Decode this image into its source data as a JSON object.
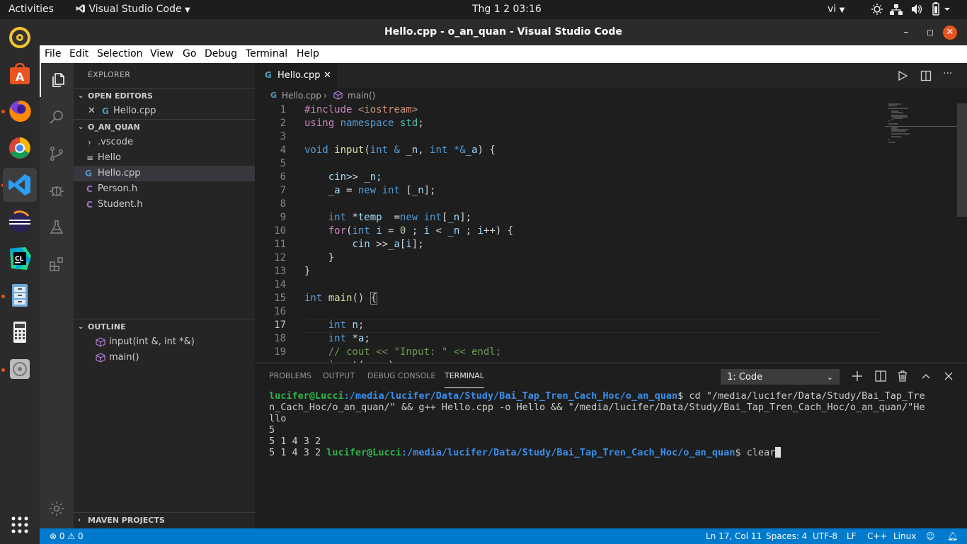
{
  "topbar": {
    "activities": "Activities",
    "app_name": "Visual Studio Code",
    "clock": "Thg 1 2  03:16",
    "lang": "vi"
  },
  "window": {
    "title": "Hello.cpp - o_an_quan - Visual Studio Code"
  },
  "menu": [
    "File",
    "Edit",
    "Selection",
    "View",
    "Go",
    "Debug",
    "Terminal",
    "Help"
  ],
  "explorer": {
    "header": "EXPLORER",
    "open_editors_label": "OPEN EDITORS",
    "open_editors": [
      {
        "icon": "G",
        "name": "Hello.cpp"
      }
    ],
    "folder_label": "O_AN_QUAN",
    "files": [
      {
        "icon": "›",
        "name": ".vscode"
      },
      {
        "icon": "≡",
        "name": "Hello"
      },
      {
        "icon": "G",
        "name": "Hello.cpp"
      },
      {
        "icon": "C",
        "name": "Person.h"
      },
      {
        "icon": "C",
        "name": "Student.h"
      }
    ],
    "outline_label": "OUTLINE",
    "outline": [
      "input(int &, int *&)",
      "main()"
    ],
    "maven_label": "MAVEN PROJECTS"
  },
  "editor": {
    "tab_name": "Hello.cpp",
    "breadcrumb_file": "Hello.cpp",
    "breadcrumb_symbol": "main()"
  },
  "panel": {
    "tabs": [
      "PROBLEMS",
      "OUTPUT",
      "DEBUG CONSOLE",
      "TERMINAL"
    ],
    "active_tab": "TERMINAL",
    "terminal_select": "1: Code",
    "terminal": {
      "user": "lucifer@Lucci",
      "path": ":/media/lucifer/Data/Study/Bai_Tap_Tren_Cach_Hoc/o_an_quan",
      "cmd1_line1": "$ cd \"/media/lucifer/Data/Study/Bai_Tap_Tre",
      "cmd1_line2": "n_Cach_Hoc/o_an_quan/\" && g++ Hello.cpp -o Hello && \"/media/lucifer/Data/Study/Bai_Tap_Tren_Cach_Hoc/o_an_quan/\"He",
      "cmd1_line3": "llo",
      "out1": "5",
      "out2": "5 1 4 3 2",
      "out3": "5 1 4 3 2 ",
      "cmd2": "$ clear"
    }
  },
  "status": {
    "errors": "0",
    "warnings": "0",
    "position": "Ln 17, Col 11",
    "spaces": "Spaces: 4",
    "encoding": "UTF-8",
    "eol": "LF",
    "language": "C++",
    "os": "Linux"
  }
}
